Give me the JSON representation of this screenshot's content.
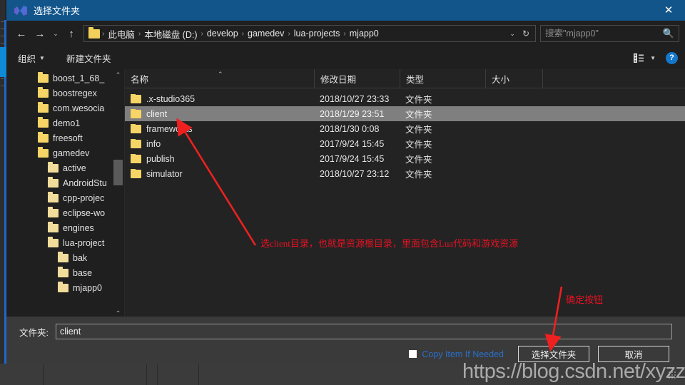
{
  "window": {
    "title": "选择文件夹",
    "icon": "app-logo-icon",
    "close_label": "✕",
    "titlebar_color": "#12558b"
  },
  "nav": {
    "back_label": "←",
    "forward_label": "→",
    "recent_label": "⌄",
    "up_label": "↑",
    "breadcrumbs": [
      "此电脑",
      "本地磁盘 (D:)",
      "develop",
      "gamedev",
      "lua-projects",
      "mjapp0"
    ],
    "separator": "›",
    "dropdown_label": "⌄",
    "refresh_label": "↻"
  },
  "search": {
    "value": "",
    "placeholder": "搜索\"mjapp0\"",
    "icon": "search-icon"
  },
  "toolbar": {
    "organize_label": "组织",
    "organize_caret": "▼",
    "new_folder_label": "新建文件夹",
    "view_icon": "list-view-icon",
    "view_caret": "▼",
    "help_label": "?"
  },
  "tree": {
    "scroll_up": "⌃",
    "scroll_down": "⌄",
    "items": [
      {
        "label": "boost_1_68_",
        "indent": 0
      },
      {
        "label": "boostregex",
        "indent": 0
      },
      {
        "label": "com.wesocia",
        "indent": 0
      },
      {
        "label": "demo1",
        "indent": 0
      },
      {
        "label": "freesoft",
        "indent": 0
      },
      {
        "label": "gamedev",
        "indent": 0
      },
      {
        "label": "active",
        "indent": 1
      },
      {
        "label": "AndroidStu",
        "indent": 1
      },
      {
        "label": "cpp-projec",
        "indent": 1
      },
      {
        "label": "eclipse-wo",
        "indent": 1
      },
      {
        "label": "engines",
        "indent": 1
      },
      {
        "label": "lua-project",
        "indent": 1
      },
      {
        "label": "bak",
        "indent": 2
      },
      {
        "label": "base",
        "indent": 2
      },
      {
        "label": "mjapp0",
        "indent": 2
      }
    ]
  },
  "filelist": {
    "columns": [
      "名称",
      "修改日期",
      "类型",
      "大小"
    ],
    "sort_caret": "⌃",
    "rows": [
      {
        "name": ".x-studio365",
        "modified": "2018/10/27 23:33",
        "type": "文件夹",
        "size": "",
        "selected": false
      },
      {
        "name": "client",
        "modified": "2018/1/29 23:51",
        "type": "文件夹",
        "size": "",
        "selected": true
      },
      {
        "name": "frameworks",
        "modified": "2018/1/30 0:08",
        "type": "文件夹",
        "size": "",
        "selected": false
      },
      {
        "name": "info",
        "modified": "2017/9/24 15:45",
        "type": "文件夹",
        "size": "",
        "selected": false
      },
      {
        "name": "publish",
        "modified": "2017/9/24 15:45",
        "type": "文件夹",
        "size": "",
        "selected": false
      },
      {
        "name": "simulator",
        "modified": "2018/10/27 23:12",
        "type": "文件夹",
        "size": "",
        "selected": false
      }
    ]
  },
  "form": {
    "folder_label": "文件夹:",
    "folder_value": "client",
    "copy_checkbox_label": "Copy Item If Needed",
    "copy_checkbox_checked": false,
    "select_button": "选择文件夹",
    "cancel_button": "取消"
  },
  "annotations": {
    "note_client": "选client目录，也就是资源根目录，里面包含Lua代码和游戏资源",
    "note_confirm": "确定按钮",
    "color": "#e81123"
  },
  "watermark": {
    "text": "https://blog.csdn.net/xyzzf"
  }
}
